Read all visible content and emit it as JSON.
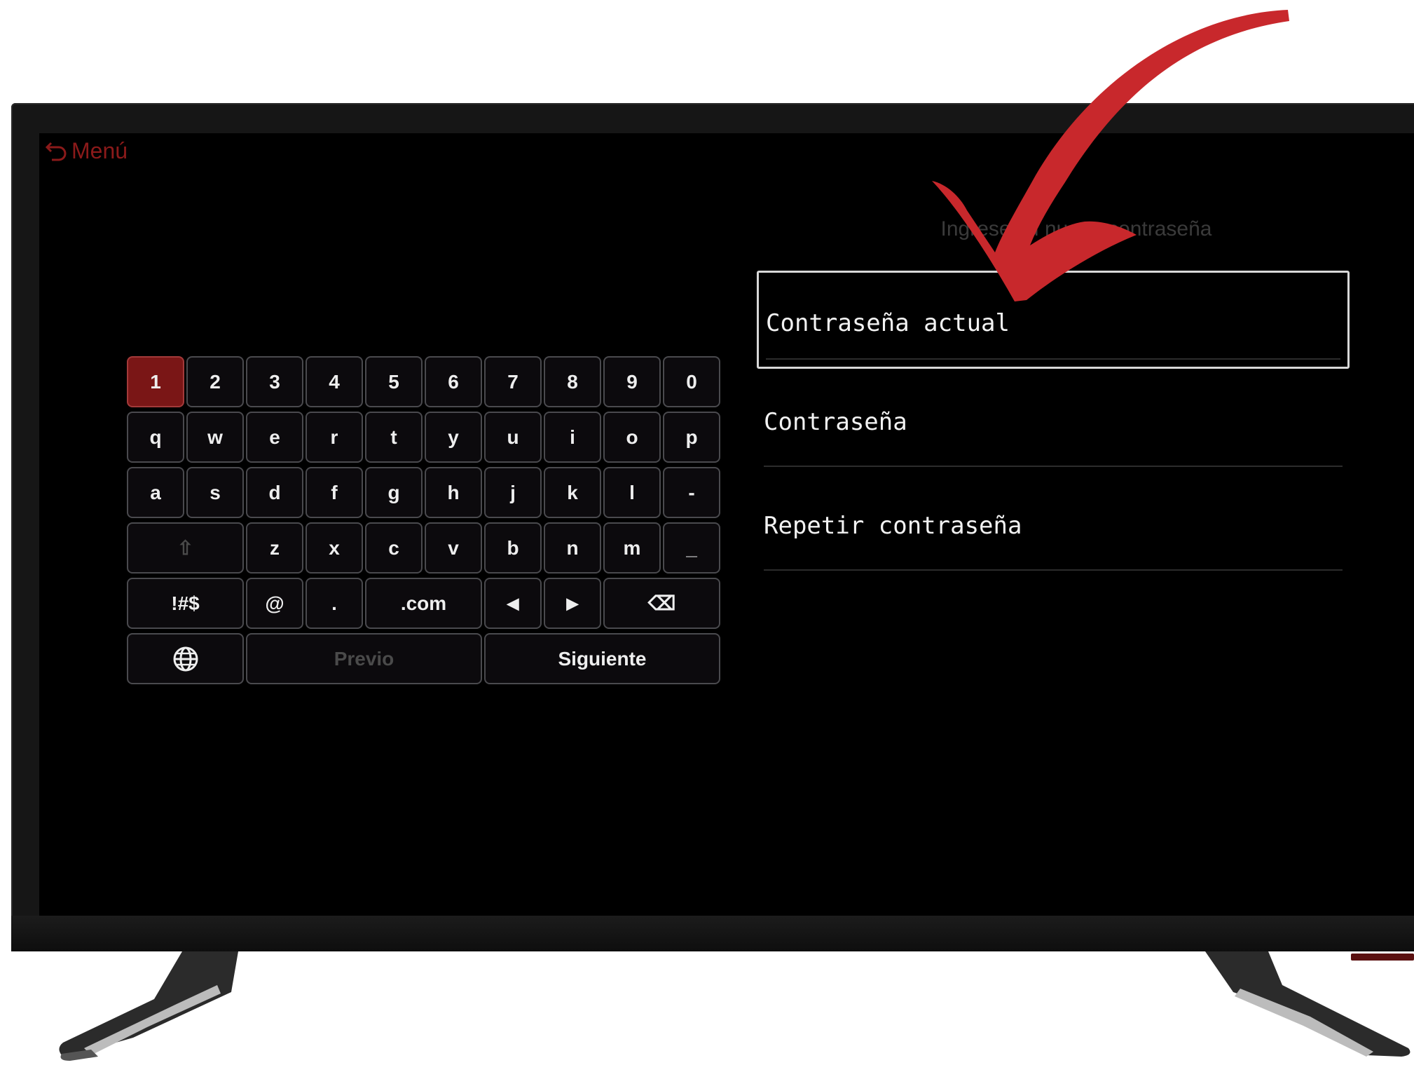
{
  "screen": {
    "back_label": "Menú",
    "prompt": "Ingrese su nueva contraseña",
    "fields": [
      {
        "label": "Contraseña actual"
      },
      {
        "label": "Contraseña"
      },
      {
        "label": "Repetir contraseña"
      }
    ]
  },
  "keyboard": {
    "row1": [
      "1",
      "2",
      "3",
      "4",
      "5",
      "6",
      "7",
      "8",
      "9",
      "0"
    ],
    "row2": [
      "q",
      "w",
      "e",
      "r",
      "t",
      "y",
      "u",
      "i",
      "o",
      "p"
    ],
    "row3": [
      "a",
      "s",
      "d",
      "f",
      "g",
      "h",
      "j",
      "k",
      "l",
      "-"
    ],
    "row4": [
      "⇧",
      "z",
      "x",
      "c",
      "v",
      "b",
      "n",
      "m",
      "_"
    ],
    "row5": [
      "!#$",
      "@",
      ".",
      ".com",
      "◀",
      "▶",
      "⌫"
    ],
    "row6": [
      "globe-icon",
      "Previo",
      "Siguiente"
    ],
    "active_key": "1"
  },
  "colors": {
    "accent": "#7a1616",
    "arrow": "#c8282c",
    "screen": "#000000"
  }
}
